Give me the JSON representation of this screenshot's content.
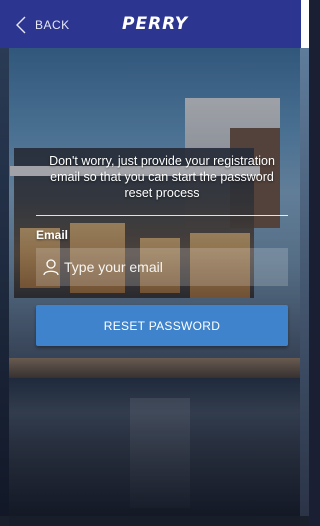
{
  "header": {
    "back_label": "BACK",
    "logo_text": "PERRY",
    "background_color": "#2c3590"
  },
  "content": {
    "instruction_text": "Don't worry, just provide your registration email so that you can start the password reset process",
    "email_label": "Email",
    "email_placeholder": "Type your email",
    "email_value": "",
    "reset_button_label": "RESET PASSWORD",
    "button_color": "#3f83cc"
  },
  "icons": {
    "back": "chevron-left-icon",
    "email_field": "user-icon"
  }
}
